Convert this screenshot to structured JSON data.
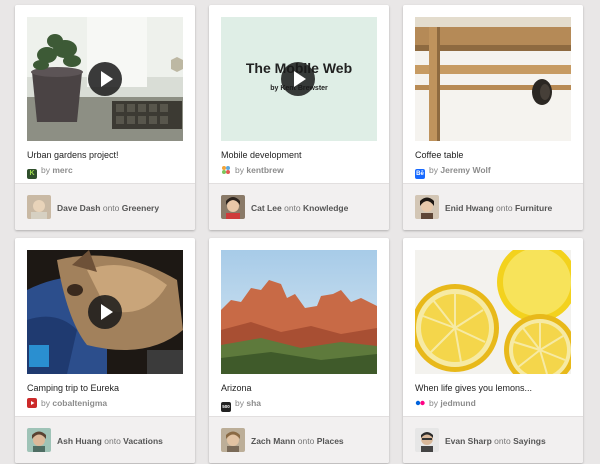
{
  "pins": [
    {
      "title": "Urban gardens project!",
      "by_prefix": "by",
      "by_user": "merc",
      "source_icon": "k-source-icon",
      "has_video": true,
      "pinner": "Dave Dash",
      "onto": "onto",
      "board": "Greenery"
    },
    {
      "title": "Mobile development",
      "by_prefix": "by",
      "by_user": "kentbrew",
      "source_icon": "slides-source-icon",
      "has_video": true,
      "slide_title": "The Mobile Web",
      "slide_subtitle": "by Kent Brewster",
      "pinner": "Cat Lee",
      "onto": "onto",
      "board": "Knowledge"
    },
    {
      "title": "Coffee table",
      "by_prefix": "by",
      "by_user": "Jeremy Wolf",
      "source_icon": "behance-source-icon",
      "source_icon_text": "Bē",
      "has_video": false,
      "pinner": "Enid Hwang",
      "onto": "onto",
      "board": "Furniture"
    },
    {
      "title": "Camping trip to Eureka",
      "by_prefix": "by",
      "by_user": "cobaltenigma",
      "source_icon": "youtube-source-icon",
      "has_video": true,
      "pinner": "Ash Huang",
      "onto": "onto",
      "board": "Vacations"
    },
    {
      "title": "Arizona",
      "by_prefix": "by",
      "by_user": "sha",
      "source_icon": "500px-source-icon",
      "source_icon_text": "500",
      "has_video": false,
      "pinner": "Zach Mann",
      "onto": "onto",
      "board": "Places"
    },
    {
      "title": "When life gives you lemons...",
      "by_prefix": "by",
      "by_user": "jedmund",
      "source_icon": "flickr-source-icon",
      "has_video": false,
      "pinner": "Evan Sharp",
      "onto": "onto",
      "board": "Sayings"
    }
  ]
}
